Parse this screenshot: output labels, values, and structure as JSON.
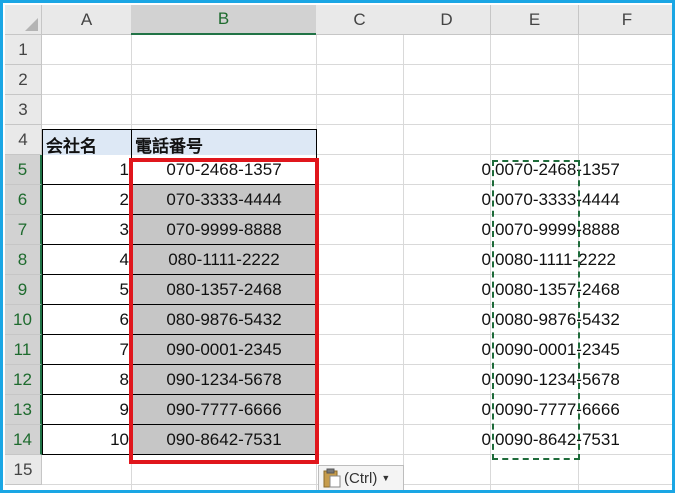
{
  "columns": [
    "A",
    "B",
    "C",
    "D",
    "E",
    "F"
  ],
  "rows": [
    "1",
    "2",
    "3",
    "4",
    "5",
    "6",
    "7",
    "8",
    "9",
    "10",
    "11",
    "12",
    "13",
    "14",
    "15"
  ],
  "headers": {
    "a4": "会社名",
    "b4": "電話番号"
  },
  "data_rows": [
    {
      "a": "1",
      "b": "070-2468-1357",
      "d": "0",
      "e": "0070-2468-1357"
    },
    {
      "a": "2",
      "b": "070-3333-4444",
      "d": "0",
      "e": "0070-3333-4444"
    },
    {
      "a": "3",
      "b": "070-9999-8888",
      "d": "0",
      "e": "0070-9999-8888"
    },
    {
      "a": "4",
      "b": "080-1111-2222",
      "d": "0",
      "e": "0080-1111-2222"
    },
    {
      "a": "5",
      "b": "080-1357-2468",
      "d": "0",
      "e": "0080-1357-2468"
    },
    {
      "a": "6",
      "b": "080-9876-5432",
      "d": "0",
      "e": "0080-9876-5432"
    },
    {
      "a": "7",
      "b": "090-0001-2345",
      "d": "0",
      "e": "0090-0001-2345"
    },
    {
      "a": "8",
      "b": "090-1234-5678",
      "d": "0",
      "e": "0090-1234-5678"
    },
    {
      "a": "9",
      "b": "090-7777-6666",
      "d": "0",
      "e": "0090-7777-6666"
    },
    {
      "a": "10",
      "b": "090-8642-7531",
      "d": "0",
      "e": "0090-8642-7531"
    }
  ],
  "paste_options": {
    "label": "(Ctrl)",
    "icon": "clipboard-icon"
  },
  "colors": {
    "frame": "#1aa6e4",
    "highlight": "#e0161c",
    "copy_border": "#1e6b3a",
    "header_fill": "#dde8f5",
    "selected_fill": "#c6c6c6"
  }
}
